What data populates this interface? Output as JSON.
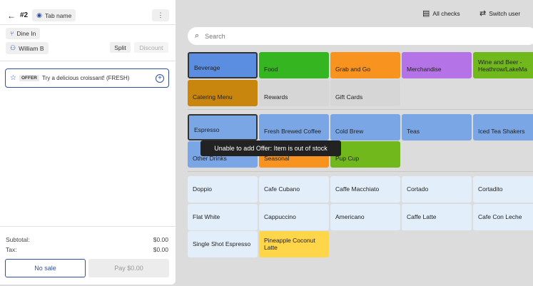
{
  "order": {
    "number": "#2",
    "tab_name": "Tab name",
    "dine_in": "Dine In",
    "server": "William B",
    "split_label": "Split",
    "discount_label": "Discount"
  },
  "offer": {
    "tag": "OFFER",
    "text": "Try a delicious croissant! (FRESH)"
  },
  "totals": {
    "subtotal_label": "Subtotal:",
    "subtotal_value": "$0.00",
    "tax_label": "Tax:",
    "tax_value": "$0.00"
  },
  "actions": {
    "no_sale": "No sale",
    "pay": "Pay $0.00"
  },
  "header": {
    "all_checks": "All checks",
    "switch_user": "Switch user",
    "search_placeholder": "Search"
  },
  "categories": [
    {
      "label": "Beverage",
      "color": "#5b8de0"
    },
    {
      "label": "Food",
      "color": "#35b51f"
    },
    {
      "label": "Grab and Go",
      "color": "#f7931e"
    },
    {
      "label": "Merchandise",
      "color": "#b473e6"
    },
    {
      "label": "Wine and Beer - Heathrow/LakeMa",
      "color": "#71b81c"
    },
    {
      "label": "Catering Menu",
      "color": "#c8860e"
    },
    {
      "label": "Rewards",
      "color": "#d6d6d6"
    },
    {
      "label": "Gift Cards",
      "color": "#d6d6d6"
    }
  ],
  "subcategories": [
    {
      "label": "Espresso",
      "color": "#7aa6e6"
    },
    {
      "label": "Fresh Brewed Coffee",
      "color": "#7aa6e6"
    },
    {
      "label": "Cold Brew",
      "color": "#7aa6e6"
    },
    {
      "label": "Teas",
      "color": "#7aa6e6"
    },
    {
      "label": "Iced Tea Shakers",
      "color": "#7aa6e6"
    },
    {
      "label": "Other Drinks",
      "color": "#7aa6e6"
    },
    {
      "label": "Seasonal",
      "color": "#f7931e"
    },
    {
      "label": "Pup Cup",
      "color": "#71b81c"
    }
  ],
  "items": [
    {
      "label": "Doppio",
      "color": "#e3eefb"
    },
    {
      "label": "Cafe Cubano",
      "color": "#e3eefb"
    },
    {
      "label": "Caffe Macchiato",
      "color": "#e3eefb"
    },
    {
      "label": "Cortado",
      "color": "#e3eefb"
    },
    {
      "label": "Cortadito",
      "color": "#e3eefb"
    },
    {
      "label": "Flat White",
      "color": "#e3eefb"
    },
    {
      "label": "Cappuccino",
      "color": "#e3eefb"
    },
    {
      "label": "Americano",
      "color": "#e3eefb"
    },
    {
      "label": "Caffe Latte",
      "color": "#e3eefb"
    },
    {
      "label": "Cafe Con Leche",
      "color": "#e3eefb"
    },
    {
      "label": "Single Shot Espresso",
      "color": "#e3eefb"
    },
    {
      "label": "Pineapple Coconut Latte",
      "color": "#ffd54a"
    }
  ],
  "toast": "Unable to add Offer: Item is out of stock"
}
